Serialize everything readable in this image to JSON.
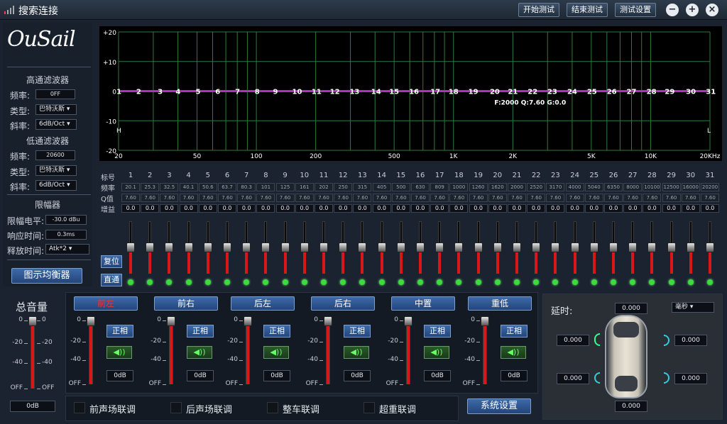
{
  "window": {
    "title": "搜索连接",
    "buttons": [
      "开始测试",
      "结束测试",
      "测试设置"
    ]
  },
  "brand": {
    "logo": "OuSail"
  },
  "highpass": {
    "title": "高通滤波器",
    "freq_label": "频率:",
    "freq": "0FF",
    "type_label": "类型:",
    "type": "巴特沃斯",
    "slope_label": "斜率:",
    "slope": "6dB/Oct"
  },
  "lowpass": {
    "title": "低通滤波器",
    "freq_label": "频率:",
    "freq": "20600",
    "type_label": "类型:",
    "type": "巴特沃斯",
    "slope_label": "斜率:",
    "slope": "6dB/Oct"
  },
  "limiter": {
    "title": "限幅器",
    "level_label": "限幅电平:",
    "level": "-30.0 dBu",
    "attack_label": "响应时间:",
    "attack": "0.3ms",
    "release_label": "释放时间:",
    "release": "Atk*2"
  },
  "eq_button": "图示均衡器",
  "chart": {
    "y_ticks": [
      "+20",
      "+10",
      "0",
      "-10",
      "-20"
    ],
    "x_ticks": [
      "20",
      "50",
      "100",
      "200",
      "500",
      "1K",
      "2K",
      "5K",
      "10K",
      "20KHz"
    ],
    "band_markers": [
      "1",
      "2",
      "3",
      "4",
      "5",
      "6",
      "7",
      "8",
      "9",
      "10",
      "11",
      "12",
      "13",
      "14",
      "15",
      "16",
      "17",
      "18",
      "19",
      "20",
      "21",
      "22",
      "23",
      "24",
      "25",
      "26",
      "27",
      "28",
      "29",
      "30",
      "31"
    ],
    "annotation": "F:2000 Q:7.60 G:0.0",
    "left_marker": "H",
    "right_marker": "L"
  },
  "eq_table": {
    "row_labels": [
      "标号",
      "频率",
      "Q值",
      "增益"
    ],
    "bands": [
      "1",
      "2",
      "3",
      "4",
      "5",
      "6",
      "7",
      "8",
      "9",
      "10",
      "11",
      "12",
      "13",
      "14",
      "15",
      "16",
      "17",
      "18",
      "19",
      "20",
      "21",
      "22",
      "23",
      "24",
      "25",
      "26",
      "27",
      "28",
      "29",
      "30",
      "31"
    ],
    "freqs": [
      "20.1",
      "25.3",
      "32.5",
      "40.1",
      "50.6",
      "63.7",
      "80.3",
      "101",
      "125",
      "161",
      "202",
      "250",
      "315",
      "405",
      "500",
      "630",
      "809",
      "1000",
      "1260",
      "1620",
      "2000",
      "2520",
      "3170",
      "4000",
      "5040",
      "6350",
      "8000",
      "10100",
      "12500",
      "16000",
      "20200"
    ],
    "q": "7.60",
    "gain": "0.0"
  },
  "eq_buttons": {
    "reset": "复位",
    "bypass": "直通"
  },
  "master": {
    "title": "总音量",
    "ticks": [
      "0",
      "-20",
      "-40",
      "OFF"
    ],
    "value": "0dB"
  },
  "channels": [
    {
      "name": "前左"
    },
    {
      "name": "前右"
    },
    {
      "name": "后左"
    },
    {
      "name": "后右"
    },
    {
      "name": "中置"
    },
    {
      "name": "重低"
    }
  ],
  "channel_common": {
    "phase": "正相",
    "value": "0dB",
    "ticks": [
      "0",
      "-20",
      "-40",
      "OFF"
    ],
    "speaker": "◀))"
  },
  "links": [
    "前声场联调",
    "后声场联调",
    "整车联调",
    "超重联调"
  ],
  "system_button": "系统设置",
  "delay": {
    "title": "延时:",
    "unit": "毫秒",
    "top": "0.000",
    "fl": "0.000",
    "fr": "0.000",
    "rl": "0.000",
    "rr": "0.000",
    "bottom": "0.000"
  }
}
